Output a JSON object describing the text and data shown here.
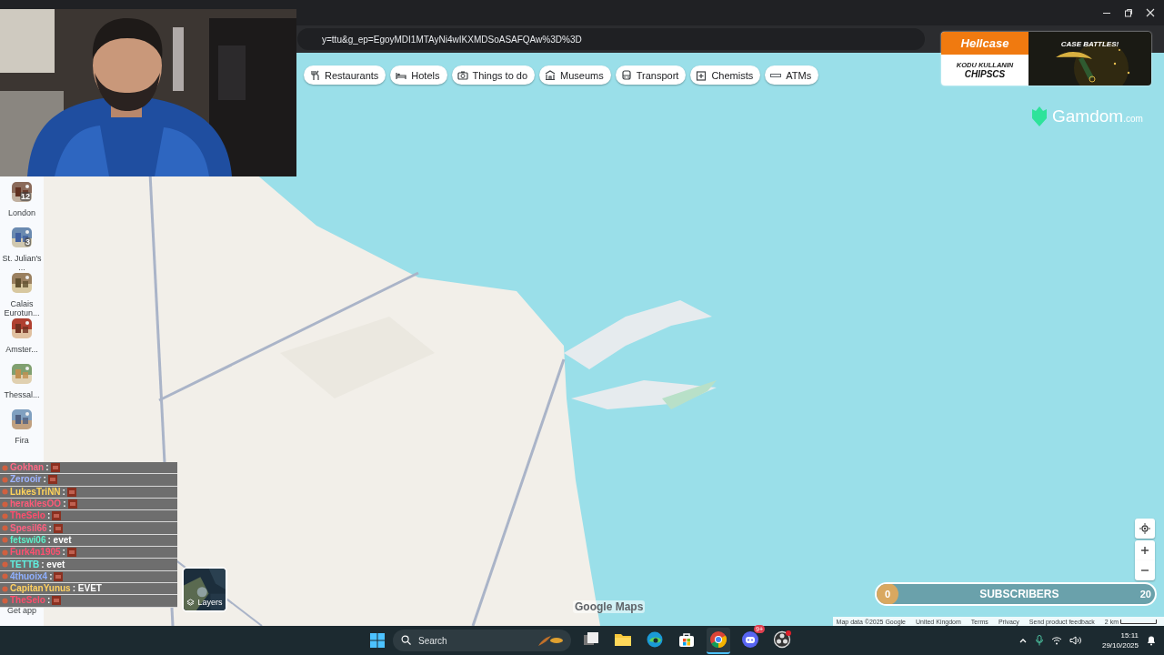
{
  "browser": {
    "url": "y=ttu&g_ep=EgoyMDI1MTAyNi4wIKXMDSoASAFQAw%3D%3D"
  },
  "sidebar": {
    "places": [
      {
        "label": "London",
        "count": "12"
      },
      {
        "label": "St. Julian's ...",
        "count": "3"
      },
      {
        "label": "Calais Eurotun..."
      },
      {
        "label": "Amster..."
      },
      {
        "label": "Thessal..."
      },
      {
        "label": "Fira"
      }
    ],
    "get_app": "Get app"
  },
  "categories": [
    {
      "kind": "restaurants",
      "label": "Restaurants"
    },
    {
      "kind": "hotels",
      "label": "Hotels"
    },
    {
      "kind": "things",
      "label": "Things to do"
    },
    {
      "kind": "museums",
      "label": "Museums"
    },
    {
      "kind": "transport",
      "label": "Transport"
    },
    {
      "kind": "chemists",
      "label": "Chemists"
    },
    {
      "kind": "atms",
      "label": "ATMs"
    }
  ],
  "map": {
    "logo": "Google Maps",
    "layers": "Layers",
    "attribution": [
      "Map data ©2025 Google",
      "United Kingdom",
      "Terms",
      "Privacy",
      "Send product feedback"
    ],
    "scale": "2 km"
  },
  "ad": {
    "brand": "Hellcase",
    "line_1": "KODU KULLANIN",
    "code": "CHIPSCS",
    "headline": "CASE BATTLES!"
  },
  "sponsor": {
    "name": "Gamdom",
    "suffix": ".com"
  },
  "chat": [
    {
      "user": "Gokhan",
      "color": "#ff6a86",
      "message": ":",
      "emote": true
    },
    {
      "user": "Zerooir",
      "color": "#9fb4ff",
      "message": ":",
      "emote": true
    },
    {
      "user": "LukesTriNN",
      "color": "#ffd35a",
      "message": ":",
      "emote": true
    },
    {
      "user": "heraklesOO",
      "color": "#ff5a78",
      "message": ":",
      "emote": true
    },
    {
      "user": "TheSelo",
      "color": "#ff4d6d",
      "message": ":",
      "emote": true
    },
    {
      "user": "Spesil66",
      "color": "#ff6080",
      "message": ":",
      "emote": true
    },
    {
      "user": "fetswi06",
      "color": "#5cf0c8",
      "message": ": evet",
      "emote": false
    },
    {
      "user": "Furk4n1905",
      "color": "#ff5070",
      "message": ":",
      "emote": true
    },
    {
      "user": "TETTB",
      "color": "#60f0e0",
      "message": ": evet",
      "emote": false
    },
    {
      "user": "4thuoix4",
      "color": "#8fb0ff",
      "message": ":",
      "emote": true
    },
    {
      "user": "CapitanYunus",
      "color": "#ffd060",
      "message": ": EVET",
      "emote": false
    },
    {
      "user": "TheSelo",
      "color": "#ff4d6d",
      "message": ":",
      "emote": true
    }
  ],
  "subscribers": {
    "current": "0",
    "label": "SUBSCRIBERS",
    "goal": "20"
  },
  "taskbar": {
    "placeholder": "Search",
    "apps": [
      {
        "kind": "taskview",
        "selected": false
      },
      {
        "kind": "explorer",
        "selected": false
      },
      {
        "kind": "edge",
        "selected": false
      },
      {
        "kind": "store",
        "selected": false
      },
      {
        "kind": "chrome",
        "selected": true
      },
      {
        "kind": "discord",
        "selected": false,
        "badge": "9+"
      },
      {
        "kind": "obs",
        "selected": false
      }
    ],
    "time": "15:11",
    "date": "29/10/2025"
  }
}
